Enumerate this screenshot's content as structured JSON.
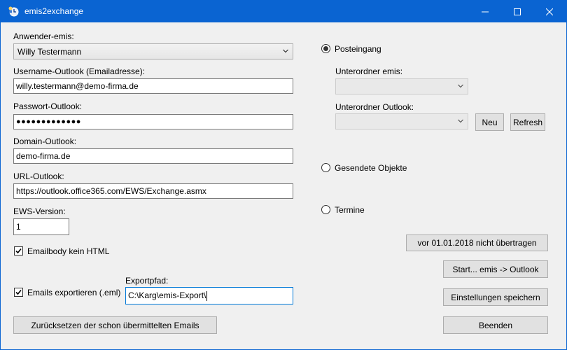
{
  "window": {
    "title": "emis2exchange",
    "app_icon": "clock-person-icon",
    "controls": {
      "minimize": "–",
      "maximize": "☐",
      "close": "✕"
    }
  },
  "form": {
    "anwender_label": "Anwender-emis:",
    "anwender_value": "Willy Testermann",
    "username_label": "Username-Outlook (Emailadresse):",
    "username_value": "willy.testermann@demo-firma.de",
    "password_label": "Passwort-Outlook:",
    "password_value": "●●●●●●●●●●●●●",
    "domain_label": "Domain-Outlook:",
    "domain_value": "demo-firma.de",
    "url_label": "URL-Outlook:",
    "url_value": "https://outlook.office365.com/EWS/Exchange.asmx",
    "ews_label": "EWS-Version:",
    "ews_value": "1",
    "emailbody_label": "Emailbody kein HTML",
    "emailbody_checked": true,
    "export_label": "Emails exportieren (.eml)",
    "export_checked": true,
    "exportpfad_label": "Exportpfad:",
    "exportpfad_value": "C:\\Karg\\emis-Export\\"
  },
  "right": {
    "posteingang_label": "Posteingang",
    "unterordner_emis_label": "Unterordner emis:",
    "unterordner_outlook_label": "Unterordner Outlook:",
    "neu_label": "Neu",
    "refresh_label": "Refresh",
    "gesendete_label": "Gesendete Objekte",
    "termine_label": "Termine",
    "selected_radio": "posteingang"
  },
  "buttons": {
    "vor_label": "vor 01.01.2018 nicht übertragen",
    "start_label": "Start... emis -> Outlook",
    "einstellungen_label": "Einstellungen speichern",
    "beenden_label": "Beenden",
    "reset_label": "Zurücksetzen der schon übermittelten Emails"
  }
}
